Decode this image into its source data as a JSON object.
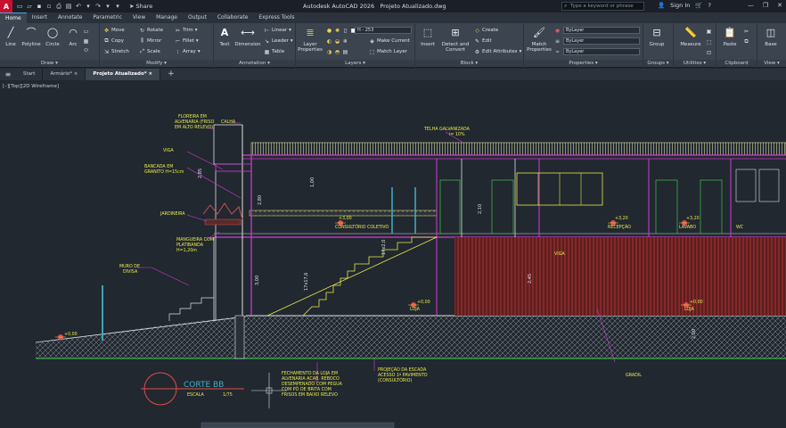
{
  "titlebar": {
    "app_letter": "A",
    "share_label": "Share",
    "title": "Autodesk AutoCAD 2026",
    "document": "Projeto Atualizado.dwg",
    "search_placeholder": "Type a keyword or phrase",
    "sign_in": "Sign In"
  },
  "tabs": [
    "Home",
    "Insert",
    "Annotate",
    "Parametric",
    "View",
    "Manage",
    "Output",
    "Collaborate",
    "Express Tools"
  ],
  "ribbon": {
    "draw": {
      "title": "Draw",
      "line": "Line",
      "polyline": "Polyline",
      "circle": "Circle",
      "arc": "Arc"
    },
    "modify": {
      "title": "Modify",
      "move": "Move",
      "rotate": "Rotate",
      "trim": "Trim",
      "copy": "Copy",
      "mirror": "Mirror",
      "fillet": "Fillet",
      "stretch": "Stretch",
      "scale": "Scale",
      "array": "Array"
    },
    "annotation": {
      "title": "Annotation",
      "text": "Text",
      "dimension": "Dimension",
      "linear": "Linear",
      "leader": "Leader",
      "table": "Table"
    },
    "layers": {
      "title": "Layers",
      "layer_properties": "Layer Properties",
      "current_layer": "H - 253",
      "make_current": "Make Current",
      "match_layer": "Match Layer"
    },
    "block": {
      "title": "Block",
      "insert": "Insert",
      "detect_convert": "Detect and Convert",
      "create": "Create",
      "edit": "Edit",
      "edit_attributes": "Edit Attributes"
    },
    "properties": {
      "title": "Properties",
      "match_properties": "Match Properties",
      "bylayer1": "ByLayer",
      "bylayer2": "ByLayer",
      "bylayer3": "ByLayer"
    },
    "groups": {
      "title": "Groups",
      "group": "Group"
    },
    "utilities": {
      "title": "Utilities",
      "measure": "Measure"
    },
    "clipboard": {
      "title": "Clipboard",
      "paste": "Paste"
    },
    "view": {
      "title": "View",
      "base": "Base"
    }
  },
  "doctabs": [
    "Start",
    "Armário*",
    "Projeto Atualizado*"
  ],
  "viewport_label": "[–][Top][2D Wireframe]",
  "drawing": {
    "labels": {
      "floreira": "FLOREIRA EM",
      "floreira2": "ALVENARIA (FRISO",
      "floreira3": "EM ALTO RELEVO)",
      "calha": "CALHA",
      "viga": "VIGA",
      "bancada": "BANCADA EM",
      "bancada2": "GRANITO H=15cm",
      "jardineira": "JARDINEIRA",
      "mangueira": "MANGUEIRA COM",
      "mangueira2": "PLATIBANDA",
      "mangueira3": "H=1,20m",
      "muro": "MURO DE",
      "muro2": "DIVISA",
      "telha": "TELHA GALVANIZADA",
      "telha2": "i= 10%",
      "consultorio": "CONSULTÓRIO COLETIVO",
      "recepcao": "RECEPÇÃO",
      "lavabo": "LAVABO",
      "loja": "LOJA",
      "wc": "WC",
      "viga2": "VIGA",
      "corte": "CORTE BB",
      "escala": "ESCALA",
      "escala_val": "1/75",
      "fechamento": "FECHAMENTO DA LOJA EM",
      "fechamento2": "ALVENARIA ACAB. REBOCO",
      "fechamento3": "DESEMPENADO COM PEGUA",
      "fechamento4": "COM PÓ DE BRITA COM",
      "fechamento5": "FRISOS EM BAIXO RELEVO",
      "projecao": "PROJEÇÃO DA ESCADA",
      "projecao2": "ACESSO 1º PAVIMENTO",
      "projecao3": "(CONSULTÓRIO)",
      "gradil": "GRADIL",
      "lev1": "+3,00",
      "lev2": "+3,20",
      "lev3": "+3,20",
      "lev4": "+0,00",
      "lev5": "+0,00",
      "lev6": "+0,00"
    }
  }
}
